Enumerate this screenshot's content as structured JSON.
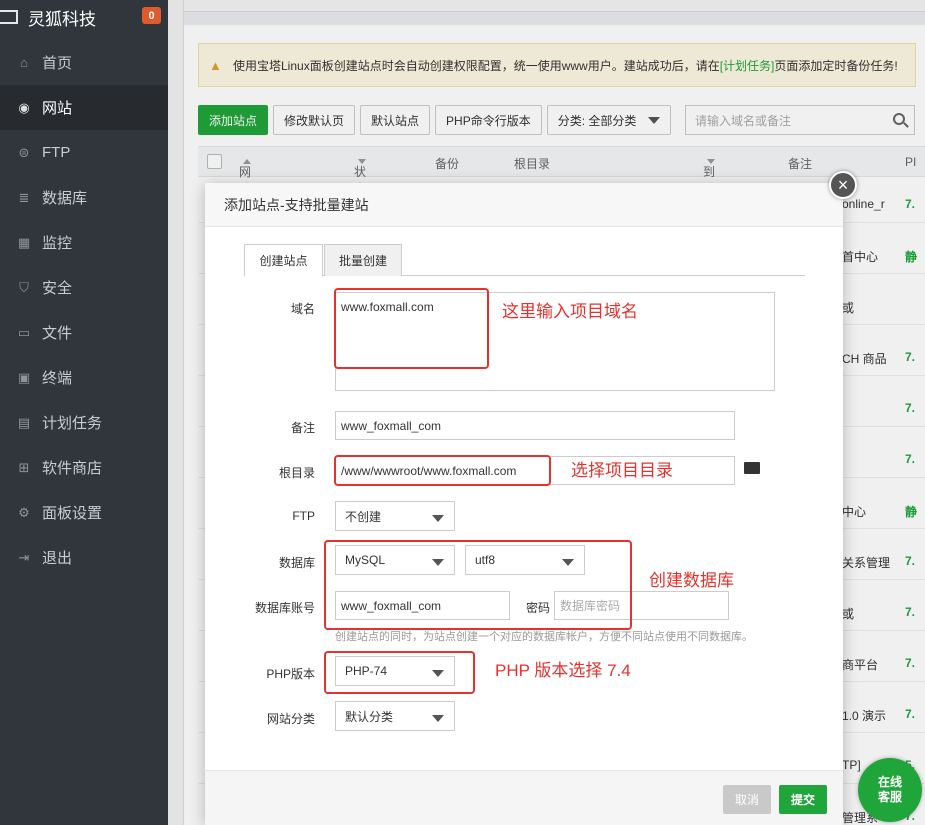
{
  "sidebar": {
    "brand": "灵狐科技",
    "badge": "0",
    "items": [
      {
        "label": "首页",
        "icon": "home-icon",
        "glyph": "⌂"
      },
      {
        "label": "网站",
        "icon": "globe-icon",
        "glyph": "◉"
      },
      {
        "label": "FTP",
        "icon": "ftp-icon",
        "glyph": "⊜"
      },
      {
        "label": "数据库",
        "icon": "database-icon",
        "glyph": "≣"
      },
      {
        "label": "监控",
        "icon": "monitor-icon",
        "glyph": "▦"
      },
      {
        "label": "安全",
        "icon": "shield-icon",
        "glyph": "⛉"
      },
      {
        "label": "文件",
        "icon": "folder-icon",
        "glyph": "▭"
      },
      {
        "label": "终端",
        "icon": "terminal-icon",
        "glyph": "▣"
      },
      {
        "label": "计划任务",
        "icon": "calendar-icon",
        "glyph": "▤"
      },
      {
        "label": "软件商店",
        "icon": "apps-icon",
        "glyph": "⊞"
      },
      {
        "label": "面板设置",
        "icon": "gear-icon",
        "glyph": "⚙"
      },
      {
        "label": "退出",
        "icon": "logout-icon",
        "glyph": "⇥"
      }
    ]
  },
  "alert": {
    "text_before": "使用宝塔Linux面板创建站点时会自动创建权限配置，统一使用www用户。建站成功后，请在",
    "link": "[计划任务]",
    "text_after": "页面添加定时备份任务!"
  },
  "toolbar": {
    "add_site": "添加站点",
    "edit_default_page": "修改默认页",
    "default_site": "默认站点",
    "php_cli": "PHP命令行版本",
    "category": "分类: 全部分类",
    "search_placeholder": "请输入域名或备注"
  },
  "table": {
    "headers": {
      "name": "网站名",
      "status": "状态",
      "backup": "备份",
      "root": "根目录",
      "expire": "到期时间",
      "remark": "备注",
      "php": "PI"
    },
    "rows": [
      {
        "remark": "online_r",
        "php": "7."
      },
      {
        "remark": "首中心",
        "php": "静"
      },
      {
        "remark": "或",
        "php": ""
      },
      {
        "remark": "CH 商品",
        "php": "7."
      },
      {
        "remark": "",
        "php": "7."
      },
      {
        "remark": "",
        "php": "7."
      },
      {
        "remark": "中心",
        "php": "静"
      },
      {
        "remark": "关系管理",
        "php": "7."
      },
      {
        "remark": "或",
        "php": "7."
      },
      {
        "remark": "商平台",
        "php": "7."
      },
      {
        "remark": "1.0 演示",
        "php": "7."
      },
      {
        "remark": "TP]",
        "php": "5."
      },
      {
        "remark": "管理系",
        "php": "7."
      }
    ]
  },
  "modal": {
    "title": "添加站点-支持批量建站",
    "tab_create": "创建站点",
    "tab_batch": "批量创建",
    "domain_label": "域名",
    "domain_value": "www.foxmall.com",
    "remark_label": "备注",
    "remark_value": "www_foxmall_com",
    "root_label": "根目录",
    "root_value": "/www/wwwroot/www.foxmall.com",
    "ftp_label": "FTP",
    "ftp_value": "不创建",
    "db_label": "数据库",
    "db_type": "MySQL",
    "db_charset": "utf8",
    "db_account_label": "数据库账号",
    "db_account_value": "www_foxmall_com",
    "db_password_label": "密码",
    "db_password_placeholder": "数据库密码",
    "db_hint": "创建站点的同时，为站点创建一个对应的数据库帐户，方便不同站点使用不同数据库。",
    "php_label": "PHP版本",
    "php_value": "PHP-74",
    "category_label": "网站分类",
    "category_value": "默认分类",
    "cancel": "取消",
    "submit": "提交"
  },
  "annotations": {
    "domain": "这里输入项目域名",
    "root": "选择项目目录",
    "database": "创建数据库",
    "php": "PHP 版本选择 7.4"
  },
  "chat": {
    "line1": "在线",
    "line2": "客服"
  },
  "colors": {
    "accent": "#20a53a",
    "annotation": "#e5322d",
    "sidebar": "#31363c"
  }
}
